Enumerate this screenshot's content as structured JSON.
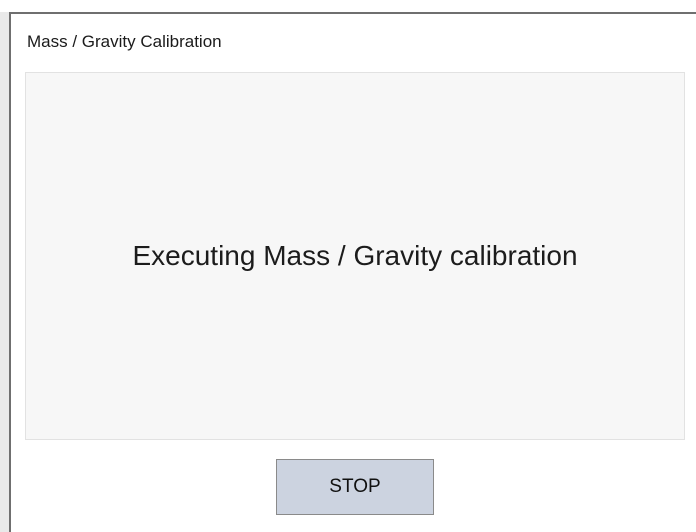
{
  "dialog": {
    "title": "Mass / Gravity Calibration",
    "message": "Executing Mass / Gravity calibration",
    "stop_label": "STOP"
  },
  "colors": {
    "panel_background": "#f7f7f7",
    "button_background": "#ccd3e0",
    "window_border": "#6f6f6f"
  }
}
